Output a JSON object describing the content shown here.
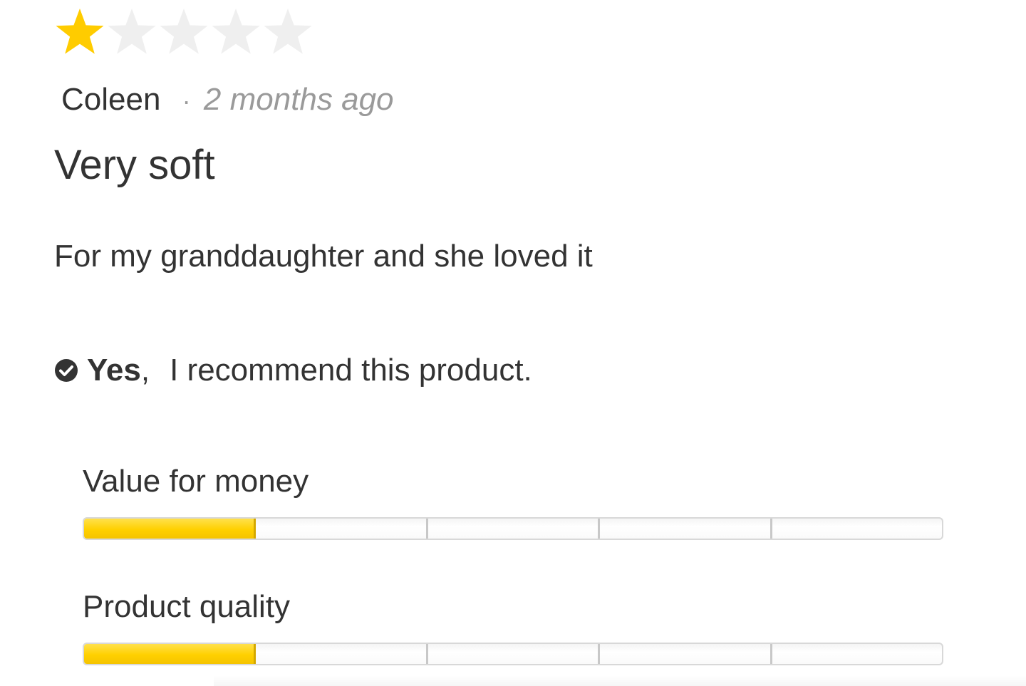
{
  "review": {
    "rating": 1,
    "max_rating": 5,
    "author": "Coleen",
    "separator": "·",
    "time_ago": "2 months ago",
    "title": "Very soft",
    "body": "For my granddaughter and she loved it",
    "recommend": {
      "yes_label": "Yes",
      "comma": ",",
      "text": "I recommend this product.",
      "icon": "check-circle-icon"
    },
    "attributes": [
      {
        "label": "Value for money",
        "value": 1,
        "max": 5
      },
      {
        "label": "Product quality",
        "value": 1,
        "max": 5
      }
    ]
  },
  "colors": {
    "star_filled": "#FFCC00",
    "star_empty": "#EFEFEF",
    "bar_fill": "#FFD000",
    "text": "#333333",
    "muted": "#9A9A9A"
  }
}
